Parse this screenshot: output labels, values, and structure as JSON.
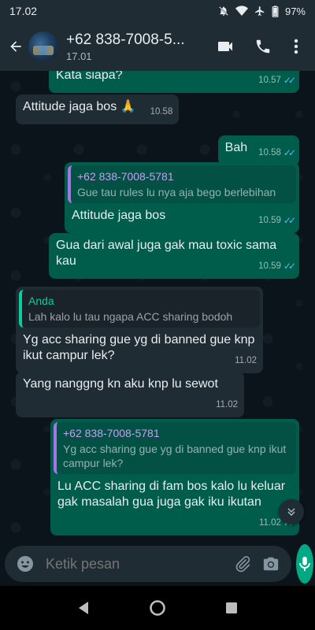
{
  "status_bar": {
    "time": "17.02",
    "battery": "97%"
  },
  "header": {
    "contact_name": "+62 838-7008-5...",
    "subtitle": "17.01"
  },
  "messages": [
    {
      "direction": "out",
      "text": "Kata siapa?",
      "time": "10.57",
      "read": true
    },
    {
      "direction": "in",
      "text": "Attitude jaga bos 🙏",
      "time": "10.58"
    },
    {
      "direction": "out",
      "text": "Bah",
      "time": "10.58",
      "read": true
    },
    {
      "direction": "out",
      "quote_name": "+62 838-7008-5781",
      "quote_text": "Gue tau rules lu nya aja bego berlebihan",
      "text": "Attitude jaga bos",
      "time": "10.59",
      "read": true
    },
    {
      "direction": "out",
      "text": "Gua dari awal juga gak mau toxic sama kau",
      "time": "10.59",
      "read": true
    },
    {
      "direction": "in",
      "quote_name": "Anda",
      "quote_text": "Lah kalo lu tau ngapa ACC sharing bodoh",
      "text": "Yg acc sharing gue yg di banned gue knp ikut campur lek?",
      "time": "11.02"
    },
    {
      "direction": "in",
      "text": "Yang nanggng kn aku knp lu sewot",
      "time": "11.02"
    },
    {
      "direction": "out",
      "quote_name": "+62 838-7008-5781",
      "quote_text": "Yg acc sharing gue yg di banned gue knp ikut campur lek?",
      "text": "Lu ACC sharing di fam bos kalo lu keluar gak masalah gua juga gak iku ikutan",
      "time": "11.02",
      "read": true
    }
  ],
  "input": {
    "placeholder": "Ketik pesan"
  },
  "colors": {
    "header_bg": "#1f2c34",
    "chat_bg": "#0b141a",
    "incoming_bubble": "#1f2c34",
    "outgoing_bubble": "#005c4b",
    "accent": "#00a884",
    "read_tick": "#53bdeb"
  }
}
